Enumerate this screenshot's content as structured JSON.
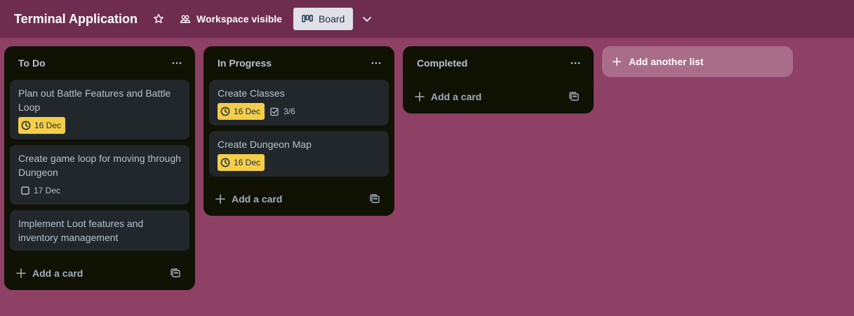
{
  "header": {
    "board_title": "Terminal Application",
    "visibility_label": "Workspace visible",
    "view_label": "Board"
  },
  "lists": [
    {
      "title": "To Do",
      "cards": [
        {
          "title": "Plan out Battle Features and Battle Loop",
          "due": "16 Dec"
        },
        {
          "title": "Create game loop for moving through Dungeon",
          "due": "17 Dec"
        },
        {
          "title": "Implement Loot features and inventory management"
        }
      ],
      "add_card_label": "Add a card"
    },
    {
      "title": "In Progress",
      "cards": [
        {
          "title": "Create Classes",
          "due": "16 Dec",
          "checklist": "3/6"
        },
        {
          "title": "Create Dungeon Map",
          "due": "16 Dec"
        }
      ],
      "add_card_label": "Add a card"
    },
    {
      "title": "Completed",
      "cards": [],
      "add_card_label": "Add a card"
    }
  ],
  "add_list_label": "Add another list",
  "colors": {
    "board_bg": "#8f4065",
    "header_bg": "#6e2d4f",
    "list_bg": "#101204",
    "card_bg": "#22272b",
    "due_badge_bg": "#f5cd47"
  },
  "icons": [
    "star-icon",
    "workspace-icon",
    "board-icon",
    "chevron-down-icon",
    "more-icon",
    "clock-icon",
    "checkbox-icon",
    "checklist-icon",
    "plus-icon",
    "template-icon"
  ]
}
